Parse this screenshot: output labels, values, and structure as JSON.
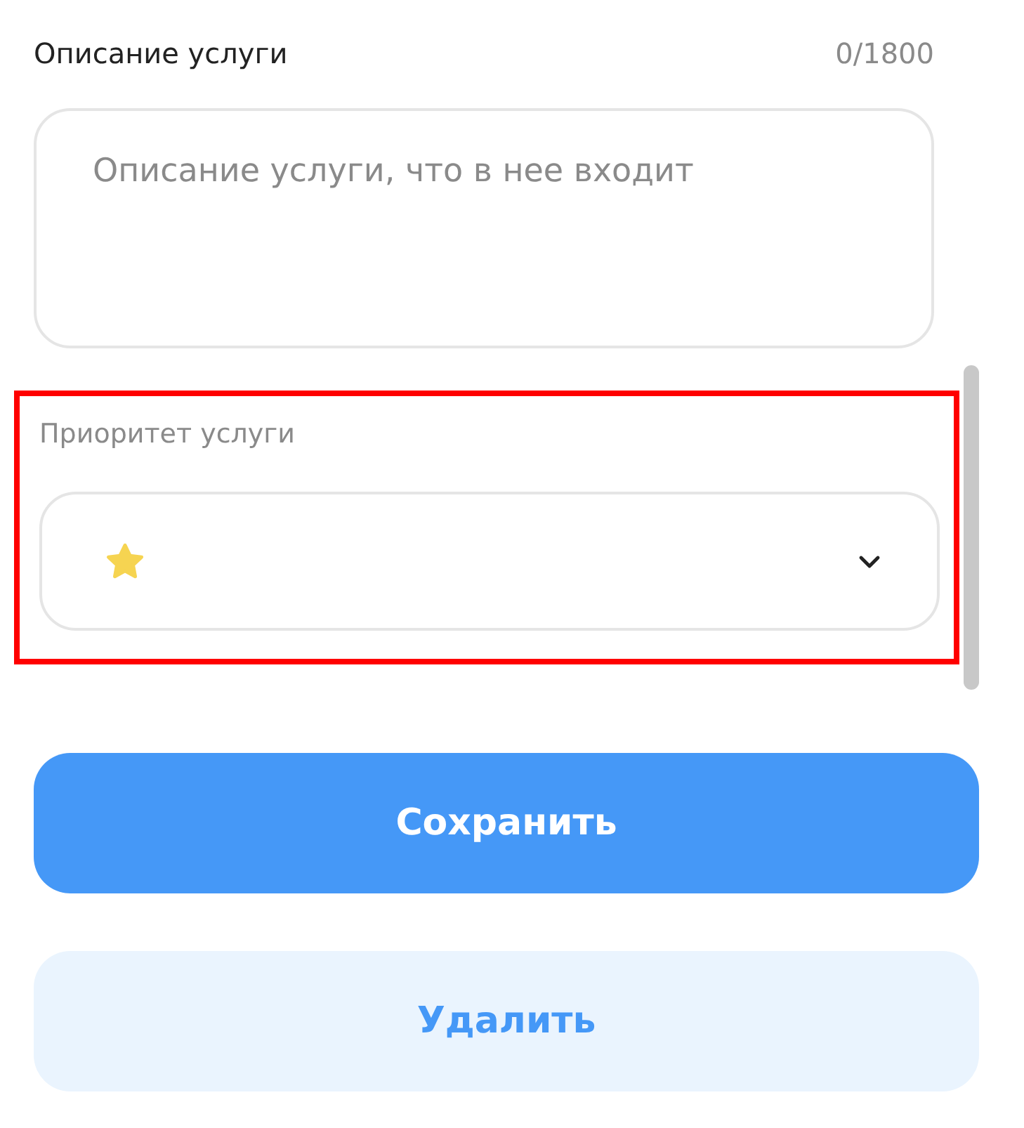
{
  "description": {
    "label": "Описание услуги",
    "counter": "0/1800",
    "placeholder": "Описание услуги, что в нее входит"
  },
  "priority": {
    "label": "Приоритет услуги",
    "highlighted": true
  },
  "buttons": [
    {
      "label": "Сохранить",
      "kind": "primary"
    },
    {
      "label": "Удалить",
      "kind": "secondary"
    }
  ]
}
